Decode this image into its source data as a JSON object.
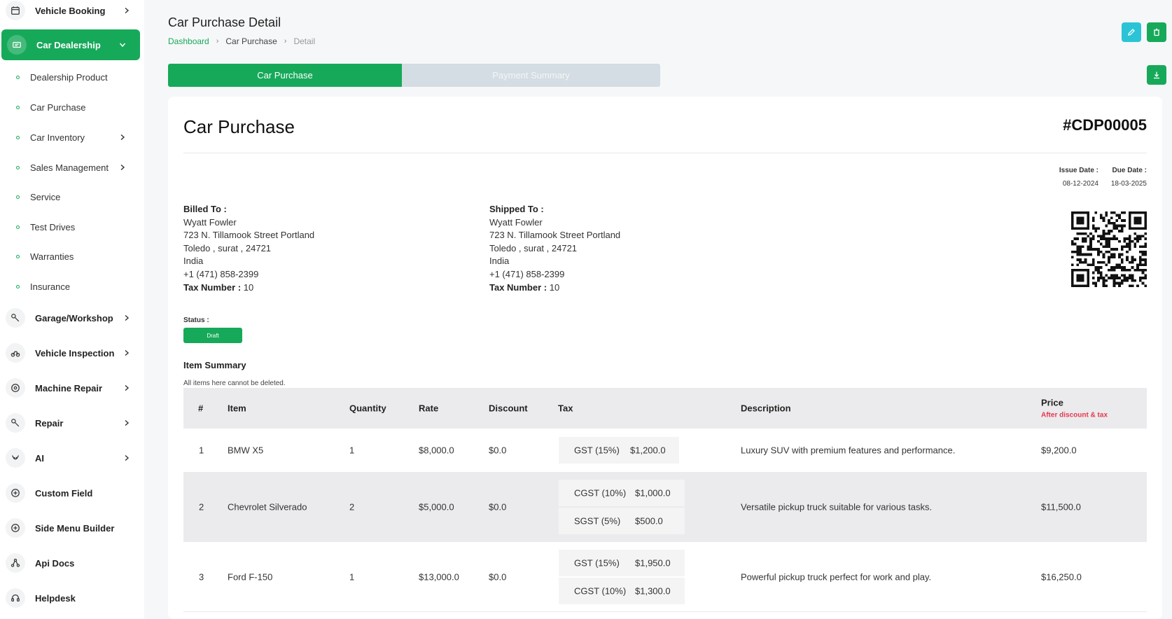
{
  "sidebar": {
    "top_items": [
      {
        "label": "Vehicle Booking"
      },
      {
        "label": "Car Dealership"
      }
    ],
    "sub_items": [
      {
        "label": "Dealership Product"
      },
      {
        "label": "Car Purchase"
      },
      {
        "label": "Car Inventory"
      },
      {
        "label": "Sales Management"
      },
      {
        "label": "Service"
      },
      {
        "label": "Test Drives"
      },
      {
        "label": "Warranties"
      },
      {
        "label": "Insurance"
      }
    ],
    "bottom_items": [
      {
        "label": "Garage/Workshop"
      },
      {
        "label": "Vehicle Inspection"
      },
      {
        "label": "Machine Repair"
      },
      {
        "label": "Repair"
      },
      {
        "label": "AI"
      },
      {
        "label": "Custom Field"
      },
      {
        "label": "Side Menu Builder"
      },
      {
        "label": "Api Docs"
      },
      {
        "label": "Helpdesk"
      }
    ]
  },
  "header": {
    "title": "Car Purchase Detail",
    "breadcrumb": [
      "Dashboard",
      "Car Purchase",
      "Detail"
    ]
  },
  "tabs": [
    {
      "label": "Car Purchase"
    },
    {
      "label": "Payment Summary"
    }
  ],
  "colors": {
    "primary": "#17a95a",
    "info": "#2bc4d6",
    "danger_text": "#e53950"
  },
  "invoice": {
    "title": "Car Purchase",
    "number": "#CDP00005",
    "issue_date_label": "Issue Date :",
    "issue_date": "08-12-2024",
    "due_date_label": "Due Date :",
    "due_date": "18-03-2025",
    "billed_to": {
      "heading": "Billed To :",
      "name": "Wyatt Fowler",
      "street": "723 N. Tillamook Street Portland",
      "city": "Toledo , surat , 24721",
      "country": "India",
      "phone": "+1 (471) 858-2399",
      "tax_label": "Tax Number :",
      "tax_value": "10"
    },
    "shipped_to": {
      "heading": "Shipped To :",
      "name": "Wyatt Fowler",
      "street": "723 N. Tillamook Street Portland",
      "city": "Toledo , surat , 24721",
      "country": "India",
      "phone": "+1 (471) 858-2399",
      "tax_label": "Tax Number :",
      "tax_value": "10"
    },
    "status_label": "Status :",
    "status": "Draft",
    "summary_title": "Item Summary",
    "summary_note": "All items here cannot be deleted."
  },
  "table": {
    "headers": [
      "#",
      "Item",
      "Quantity",
      "Rate",
      "Discount",
      "Tax",
      "Description",
      "Price"
    ],
    "price_sub": "After discount & tax",
    "rows": [
      {
        "num": "1",
        "item": "BMW X5",
        "qty": "1",
        "rate": "$8,000.0",
        "discount": "$0.0",
        "taxes": [
          {
            "name": "GST (15%)",
            "value": "$1,200.0"
          }
        ],
        "description": "Luxury SUV with premium features and performance.",
        "price": "$9,200.0"
      },
      {
        "num": "2",
        "item": "Chevrolet Silverado",
        "qty": "2",
        "rate": "$5,000.0",
        "discount": "$0.0",
        "taxes": [
          {
            "name": "CGST (10%)",
            "value": "$1,000.0"
          },
          {
            "name": "SGST (5%)",
            "value": "$500.0"
          }
        ],
        "description": "Versatile pickup truck suitable for various tasks.",
        "price": "$11,500.0"
      },
      {
        "num": "3",
        "item": "Ford F-150",
        "qty": "1",
        "rate": "$13,000.0",
        "discount": "$0.0",
        "taxes": [
          {
            "name": "GST (15%)",
            "value": "$1,950.0"
          },
          {
            "name": "CGST (10%)",
            "value": "$1,300.0"
          }
        ],
        "description": "Powerful pickup truck perfect for work and play.",
        "price": "$16,250.0"
      }
    ]
  }
}
